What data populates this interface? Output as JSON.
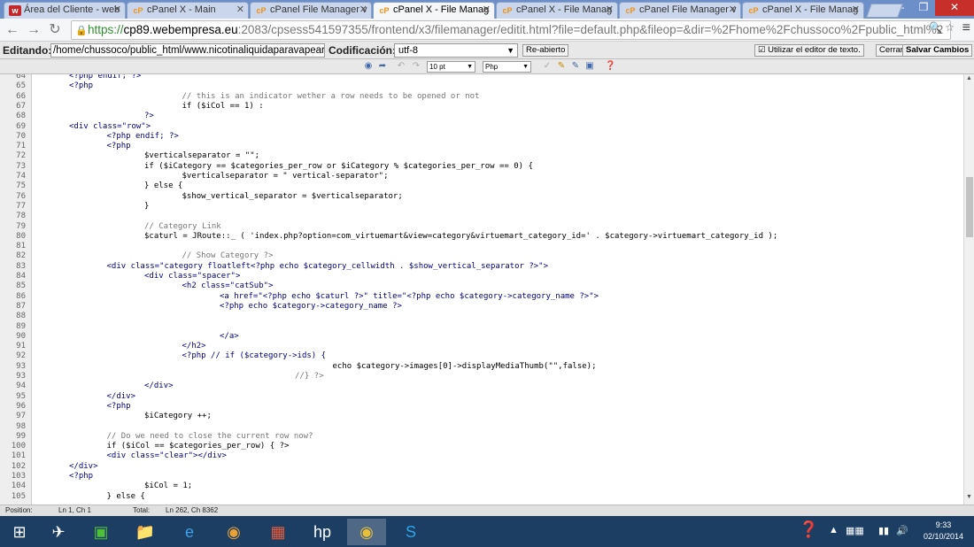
{
  "browser": {
    "tabs": [
      {
        "title": "Área del Cliente - web",
        "icon": "w",
        "active": false
      },
      {
        "title": "cPanel X - Main",
        "icon": "cP",
        "active": false
      },
      {
        "title": "cPanel File Manager v",
        "icon": "cP",
        "active": false
      },
      {
        "title": "cPanel X - File Manag",
        "icon": "cP",
        "active": true
      },
      {
        "title": "cPanel X - File Manag",
        "icon": "cP",
        "active": false
      },
      {
        "title": "cPanel File Manager v",
        "icon": "cP",
        "active": false
      },
      {
        "title": "cPanel X - File Manag",
        "icon": "cP",
        "active": false
      }
    ],
    "url_scheme": "https://",
    "url_host": "cp89.webempresa.eu",
    "url_rest": ":2083/cpsess541597355/frontend/x3/filemanager/editit.html?file=default.php&fileop=&dir=%2Fhome%2Fchussoco%2Fpublic_html%2"
  },
  "editor": {
    "editing_label": "Editando:",
    "path": "/home/chussoco/public_html/www.nicotinaliquidaparavapear.con",
    "encoding_label": "Codificación:",
    "encoding_value": "utf-8",
    "reopen_label": "Re-abierto",
    "use_text_editor_label": "Utilizar el editor de texto.",
    "close_label": "Cerrar",
    "save_label": "Salvar Cambios",
    "font_size": "10 pt",
    "syntax": "Php"
  },
  "code_lines": [
    {
      "n": "64",
      "indent": 0,
      "text": "<?php endif; ?>",
      "kind": "k"
    },
    {
      "n": "65",
      "indent": 0,
      "text": "<?php",
      "kind": "k"
    },
    {
      "n": "66",
      "indent": 3,
      "text": "// this is an indicator wether a row needs to be opened or not",
      "kind": "c"
    },
    {
      "n": "67",
      "indent": 3,
      "text": "if ($iCol == 1) :",
      "kind": ""
    },
    {
      "n": "68",
      "indent": 2,
      "text": "?>",
      "kind": "k"
    },
    {
      "n": "69",
      "indent": 0,
      "text": "<div class=\"row\">",
      "kind": "k"
    },
    {
      "n": "70",
      "indent": 1,
      "text": "<?php endif; ?>",
      "kind": "k"
    },
    {
      "n": "71",
      "indent": 1,
      "text": "<?php",
      "kind": "k"
    },
    {
      "n": "72",
      "indent": 2,
      "text": "$verticalseparator = \"\";",
      "kind": ""
    },
    {
      "n": "73",
      "indent": 2,
      "text": "if ($iCategory == $categories_per_row or $iCategory % $categories_per_row == 0) {",
      "kind": ""
    },
    {
      "n": "74",
      "indent": 3,
      "text": "$verticalseparator = \" vertical-separator\";",
      "kind": ""
    },
    {
      "n": "75",
      "indent": 2,
      "text": "} else {",
      "kind": ""
    },
    {
      "n": "76",
      "indent": 3,
      "text": "$show_vertical_separator = $verticalseparator;",
      "kind": ""
    },
    {
      "n": "77",
      "indent": 2,
      "text": "}",
      "kind": ""
    },
    {
      "n": "78",
      "indent": 0,
      "text": "",
      "kind": ""
    },
    {
      "n": "79",
      "indent": 2,
      "text": "// Category Link",
      "kind": "c"
    },
    {
      "n": "80",
      "indent": 2,
      "text": "$caturl = JRoute::_ ( 'index.php?option=com_virtuemart&view=category&virtuemart_category_id=' . $category->virtuemart_category_id );",
      "kind": ""
    },
    {
      "n": "81",
      "indent": 0,
      "text": "",
      "kind": ""
    },
    {
      "n": "82",
      "indent": 3,
      "text": "// Show Category ?>",
      "kind": "c"
    },
    {
      "n": "83",
      "indent": 1,
      "text": "<div class=\"category floatleft<?php echo $category_cellwidth . $show_vertical_separator ?>\">",
      "kind": "k"
    },
    {
      "n": "84",
      "indent": 2,
      "text": "<div class=\"spacer\">",
      "kind": "k"
    },
    {
      "n": "85",
      "indent": 3,
      "text": "<h2 class=\"catSub\">",
      "kind": "k"
    },
    {
      "n": "86",
      "indent": 4,
      "text": "<a href=\"<?php echo $caturl ?>\" title=\"<?php echo $category->category_name ?>\">",
      "kind": "k"
    },
    {
      "n": "87",
      "indent": 4,
      "text": "<?php echo $category->category_name ?>",
      "kind": "k"
    },
    {
      "n": "88",
      "indent": 0,
      "text": "",
      "kind": ""
    },
    {
      "n": "89",
      "indent": 0,
      "text": "",
      "kind": ""
    },
    {
      "n": "90",
      "indent": 4,
      "text": "</a>",
      "kind": "k"
    },
    {
      "n": "91",
      "indent": 3,
      "text": "</h2>",
      "kind": "k"
    },
    {
      "n": "92",
      "indent": 3,
      "text": "<?php // if ($category->ids) {",
      "kind": "k"
    },
    {
      "n": "93",
      "indent": 7,
      "text": "echo $category->images[0]->displayMediaThumb(\"\",false);",
      "kind": ""
    },
    {
      "n": "93",
      "indent": 6,
      "text": "//} ?>",
      "kind": "c"
    },
    {
      "n": "94",
      "indent": 2,
      "text": "</div>",
      "kind": "k"
    },
    {
      "n": "95",
      "indent": 1,
      "text": "</div>",
      "kind": "k"
    },
    {
      "n": "96",
      "indent": 1,
      "text": "<?php",
      "kind": "k"
    },
    {
      "n": "97",
      "indent": 2,
      "text": "$iCategory ++;",
      "kind": ""
    },
    {
      "n": "98",
      "indent": 0,
      "text": "",
      "kind": ""
    },
    {
      "n": "99",
      "indent": 1,
      "text": "// Do we need to close the current row now?",
      "kind": "c"
    },
    {
      "n": "100",
      "indent": 1,
      "text": "if ($iCol == $categories_per_row) { ?>",
      "kind": ""
    },
    {
      "n": "101",
      "indent": 1,
      "text": "<div class=\"clear\"></div>",
      "kind": "k"
    },
    {
      "n": "102",
      "indent": 0,
      "text": "</div>",
      "kind": "k"
    },
    {
      "n": "103",
      "indent": 0,
      "text": "<?php",
      "kind": "k"
    },
    {
      "n": "104",
      "indent": 2,
      "text": "$iCol = 1;",
      "kind": ""
    },
    {
      "n": "105",
      "indent": 1,
      "text": "} else {",
      "kind": ""
    }
  ],
  "status": {
    "position_label": "Position:",
    "position_value": "Ln 1, Ch 1",
    "total_label": "Total:",
    "total_value": "Ln 262, Ch 8362"
  },
  "taskbar": {
    "time": "9:33",
    "date": "02/10/2014"
  },
  "colors": {
    "tabstrip": "#6d8fc9",
    "https_green": "#2f8e2f",
    "taskbar": "#1d3e63"
  }
}
